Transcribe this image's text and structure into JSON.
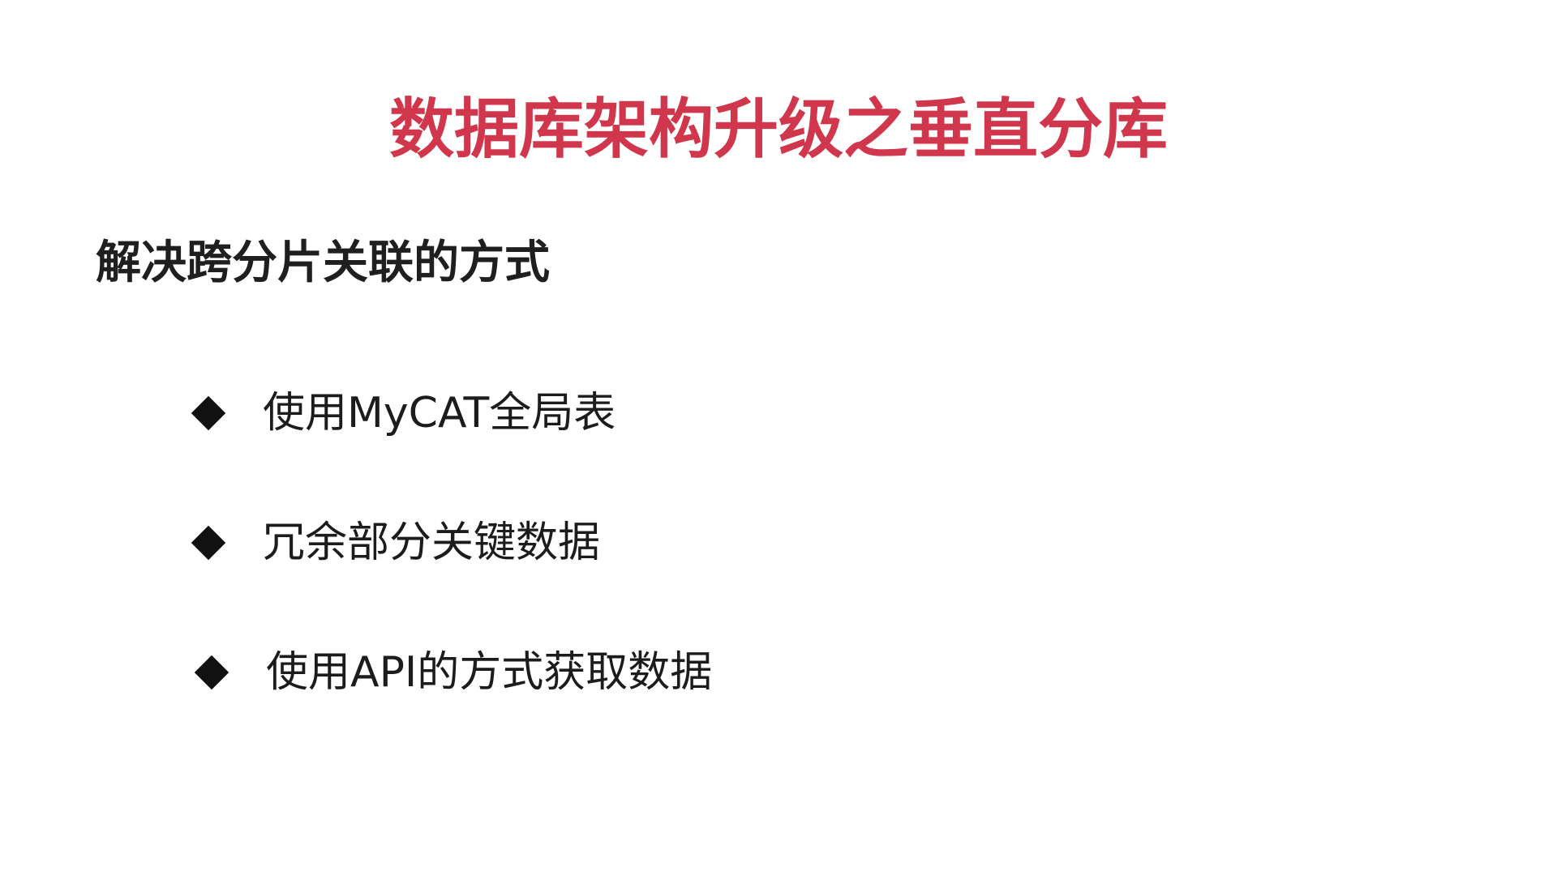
{
  "slide": {
    "title": "数据库架构升级之垂直分库",
    "subtitle": "解决跨分片关联的方式",
    "bullets": [
      {
        "icon": "diamond-bullet-icon",
        "text": "使用MyCAT全局表"
      },
      {
        "icon": "diamond-bullet-icon",
        "text": "冗余部分关键数据"
      },
      {
        "icon": "diamond-bullet-icon",
        "text": "使用API的方式获取数据"
      }
    ]
  },
  "colors": {
    "title": "#d0374c",
    "text": "#1c1c1c",
    "background": "#ffffff"
  }
}
